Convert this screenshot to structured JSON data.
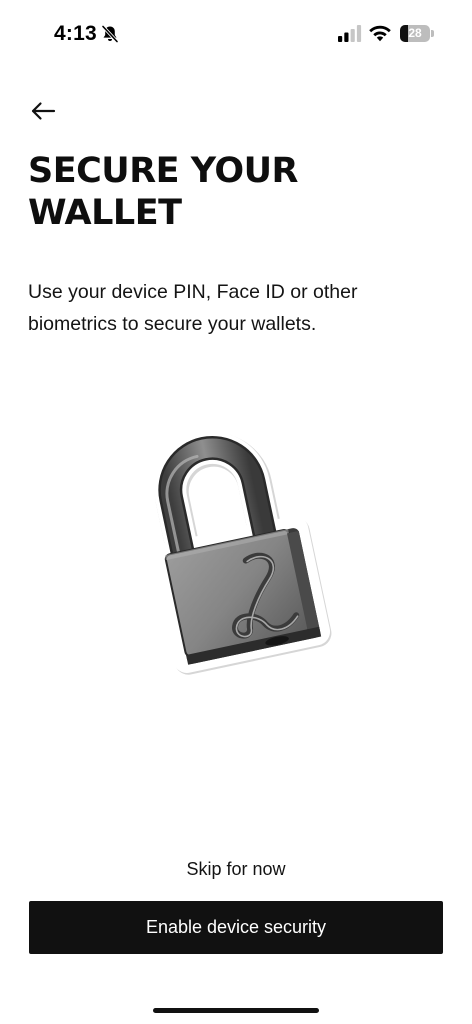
{
  "status_bar": {
    "time": "4:13",
    "battery_level": 28,
    "battery_label": "28",
    "silent_mode": true,
    "signal_bars_active": 2,
    "signal_bars_total": 4
  },
  "header": {
    "back_icon": "arrow-left-icon"
  },
  "title": {
    "line1": "SECURE YOUR",
    "line2": "WALLET"
  },
  "description": {
    "line1": "Use your device PIN, Face ID or other",
    "line2": "biometrics to secure your wallets."
  },
  "illustration": {
    "icon": "padlock-icon",
    "letter": "L"
  },
  "actions": {
    "skip_label": "Skip for now",
    "primary_label": "Enable device security"
  },
  "colors": {
    "background": "#ffffff",
    "text": "#111111",
    "button_background": "#111111",
    "button_text": "#ffffff"
  }
}
